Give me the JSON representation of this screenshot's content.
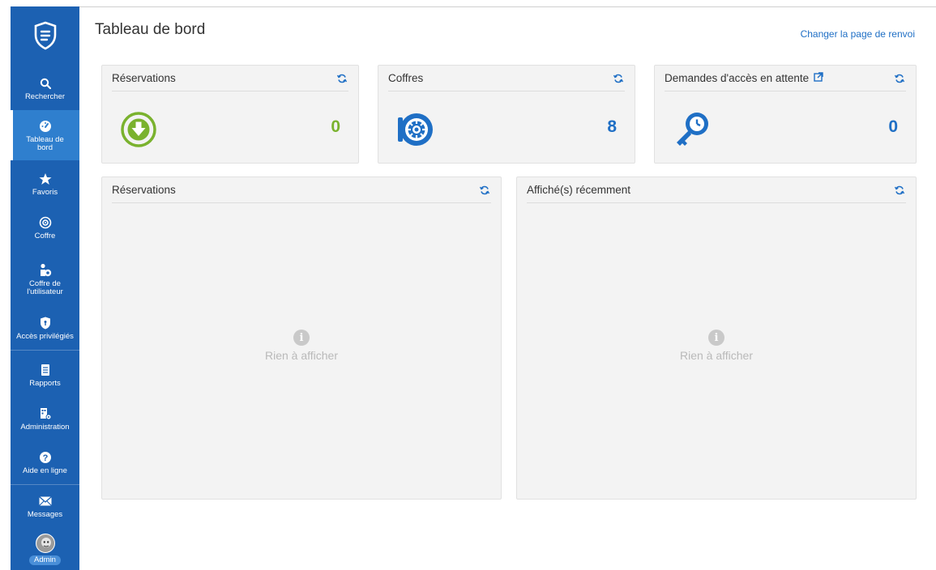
{
  "sidebar": {
    "items": [
      {
        "label": "Rechercher",
        "icon": "search-icon"
      },
      {
        "label": "Tableau de bord",
        "icon": "dashboard-icon",
        "active": true
      },
      {
        "label": "Favoris",
        "icon": "star-icon"
      },
      {
        "label": "Coffre",
        "icon": "vault-icon"
      },
      {
        "label": "Coffre de l'utilisateur",
        "icon": "user-vault-icon"
      },
      {
        "label": "Accès privilégiés",
        "icon": "shield-icon"
      },
      {
        "label": "Rapports",
        "icon": "report-icon"
      },
      {
        "label": "Administration",
        "icon": "administration-icon"
      },
      {
        "label": "Aide en ligne",
        "icon": "help-icon"
      },
      {
        "label": "Messages",
        "icon": "envelope-icon"
      }
    ],
    "user_badge": "Admin"
  },
  "header": {
    "title": "Tableau de bord",
    "change_landing_link": "Changer la page de renvoi"
  },
  "widgets": {
    "reservations_summary": {
      "title": "Réservations",
      "count": "0",
      "color": "#7ab22e"
    },
    "vaults": {
      "title": "Coffres",
      "count": "8",
      "color": "#1f6fc5"
    },
    "pending_requests": {
      "title": "Demandes d'accès en attente",
      "count": "0",
      "color": "#1f6fc5"
    },
    "reservations_list": {
      "title": "Réservations",
      "empty_text": "Rien à afficher"
    },
    "recently_viewed": {
      "title": "Affiché(s) récemment",
      "empty_text": "Rien à afficher"
    }
  },
  "colors": {
    "sidebar": "#1c61b2",
    "accent": "#1f6fc5",
    "green": "#7ab22e"
  }
}
